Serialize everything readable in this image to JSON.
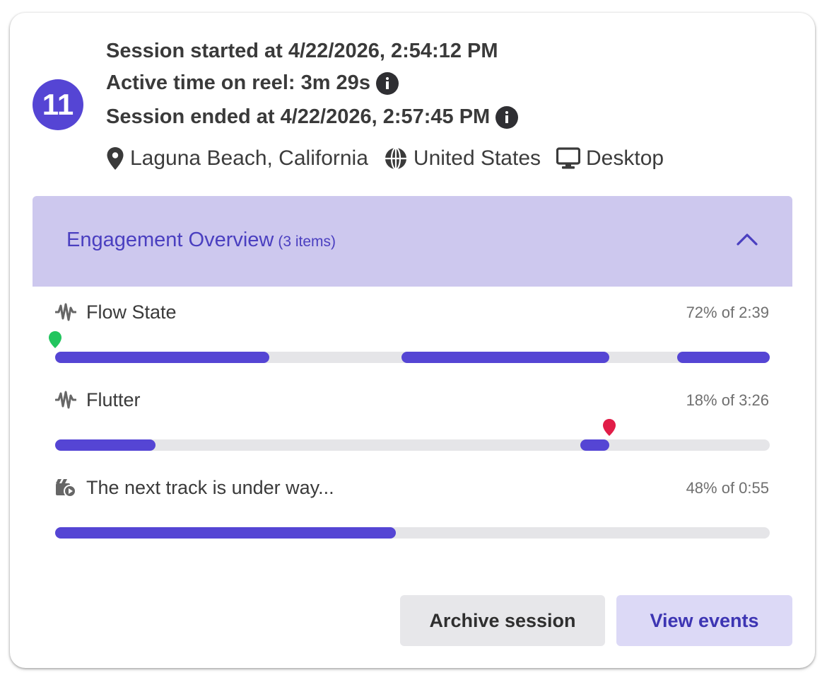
{
  "session": {
    "number": "11",
    "started": "Session started at 4/22/2026, 2:54:12 PM",
    "active": "Active time on reel: 3m 29s",
    "ended": "Session ended at 4/22/2026, 2:57:45 PM",
    "city": "Laguna Beach, California",
    "country": "United States",
    "device": "Desktop"
  },
  "panel": {
    "title": "Engagement Overview",
    "count": "(3 items)",
    "expanded": true
  },
  "rows": [
    {
      "label": "Flow State",
      "icon": "waveform-icon",
      "stat": "72% of 2:39",
      "segments": [
        [
          0,
          0.3
        ],
        [
          0.485,
          0.775
        ],
        [
          0.87,
          1.0
        ]
      ],
      "pin": {
        "color": "#22c55e",
        "position": 0
      }
    },
    {
      "label": "Flutter",
      "icon": "waveform-icon",
      "stat": "18% of 3:26",
      "segments": [
        [
          0,
          0.14
        ],
        [
          0.735,
          0.775
        ]
      ],
      "pin": {
        "color": "#e11d48",
        "position": 0.775
      }
    },
    {
      "label": "The next track is under way...",
      "icon": "clapperboard-play-icon",
      "stat": "48% of 0:55",
      "segments": [
        [
          0,
          0.477
        ]
      ],
      "pin": null
    }
  ],
  "buttons": {
    "archive": "Archive session",
    "view": "View events"
  },
  "colors": {
    "accent": "#5545d4",
    "track": "#e5e5e8",
    "panel_bg": "#cdc8ee"
  }
}
